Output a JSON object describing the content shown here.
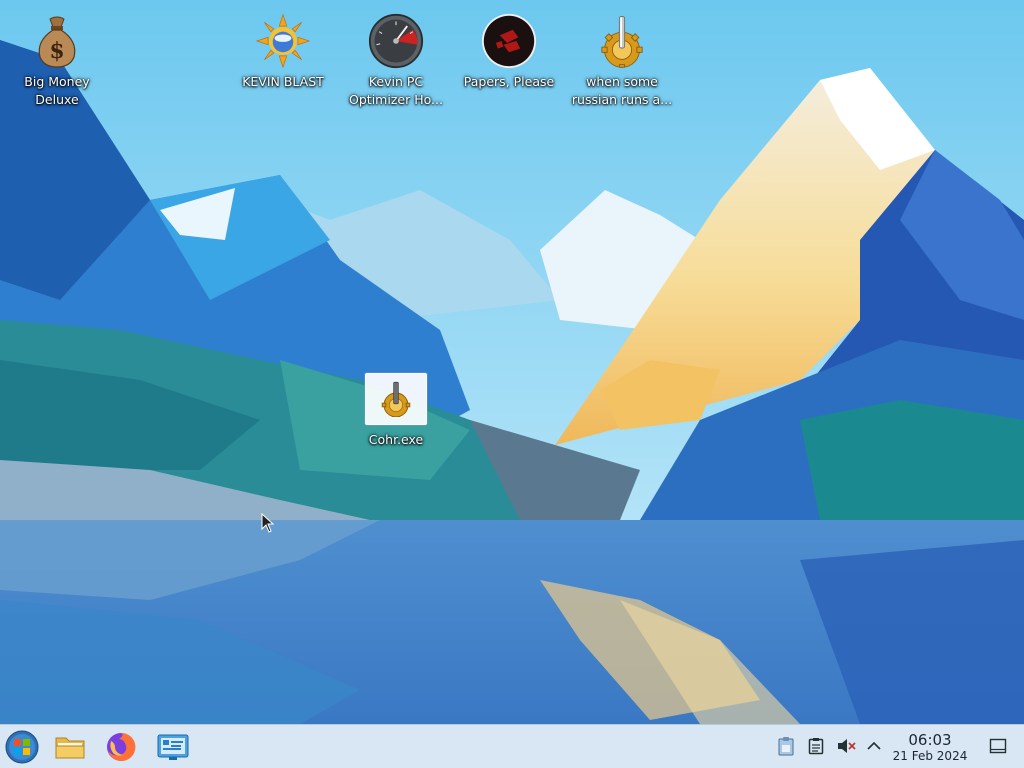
{
  "desktop": {
    "icons": [
      {
        "label": "Big Money\nDeluxe"
      },
      {
        "label": "KEVIN BLAST"
      },
      {
        "label": "Kevin PC\nOptimizer Ho..."
      },
      {
        "label": "Papers, Please"
      },
      {
        "label": "when some\nrussian runs a..."
      },
      {
        "label": "Cohr.exe"
      }
    ]
  },
  "taskbar": {
    "clock_time": "06:03",
    "clock_date": "21 Feb 2024"
  },
  "colors": {
    "taskbar_bg": "#d9e6f3",
    "label_text": "#ffffff"
  }
}
